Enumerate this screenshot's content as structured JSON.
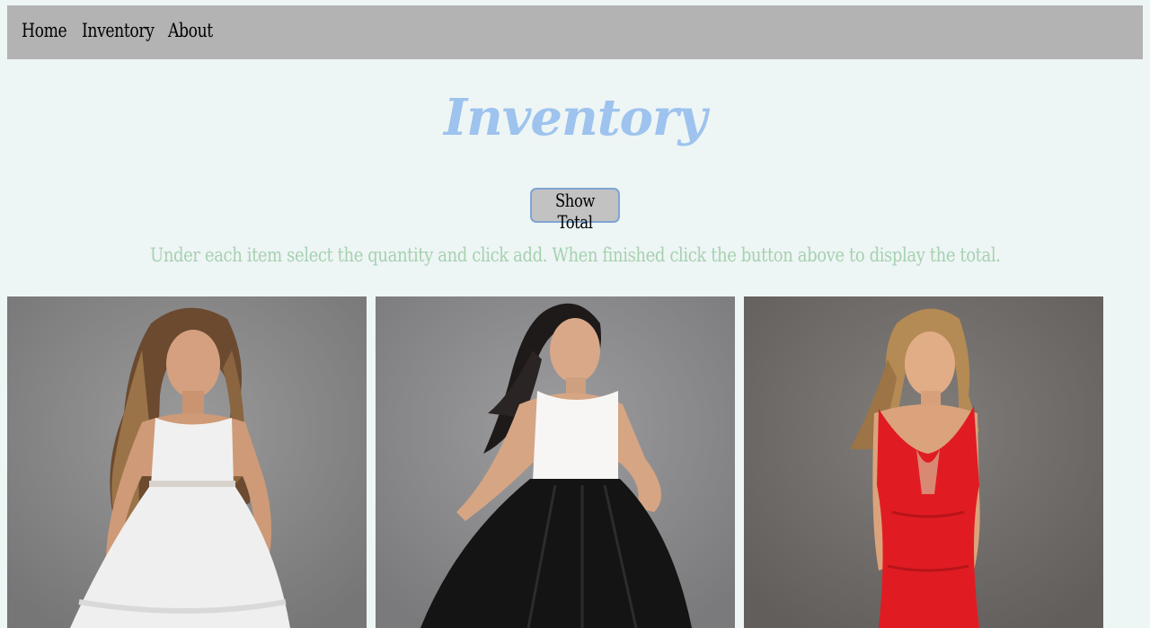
{
  "nav": {
    "items": [
      {
        "label": "Home"
      },
      {
        "label": "Inventory"
      },
      {
        "label": "About"
      }
    ]
  },
  "page": {
    "title": "Inventory",
    "show_total_label": "Show Total",
    "instructions": "Under each item select the quantity and click add. When finished click the button above to display the total."
  },
  "products": [
    {
      "image": "white-lace-short-dress-photo"
    },
    {
      "image": "black-white-halter-dress-photo"
    },
    {
      "image": "red-lace-long-gown-photo"
    }
  ],
  "colors": {
    "nav_bg": "#b3b3b3",
    "title": "#9dc3ee",
    "instructions": "#a6d1b0",
    "page_bg": "#eef5f5",
    "button_bg": "#c2c2c2",
    "button_border": "#7fa4d2"
  }
}
